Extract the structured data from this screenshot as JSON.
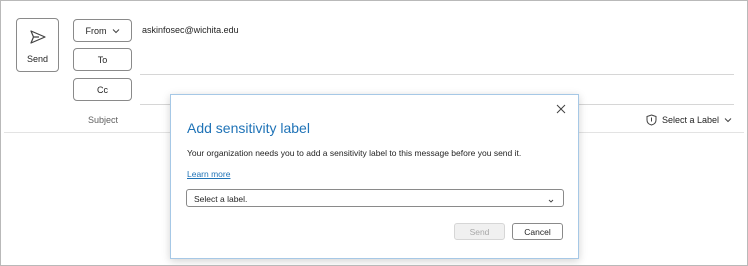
{
  "compose": {
    "send_label": "Send",
    "from_label": "From",
    "from_address": "askinfosec@wichita.edu",
    "to_label": "To",
    "cc_label": "Cc",
    "subject_placeholder": "Subject",
    "sensitivity_select_label": "Select a Label"
  },
  "dialog": {
    "title": "Add sensitivity label",
    "message": "Your organization needs you to add a sensitivity label to this message before you send it.",
    "learn_more": "Learn more",
    "dropdown_value": "Select a label.",
    "send_label": "Send",
    "cancel_label": "Cancel"
  },
  "colors": {
    "accent": "#1f73b7",
    "disabled_text": "#a8a8a8"
  },
  "icons": [
    "send-icon",
    "chevron-down-icon",
    "shield-icon",
    "close-icon"
  ]
}
